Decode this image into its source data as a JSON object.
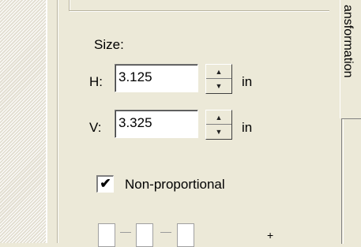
{
  "size": {
    "label": "Size:",
    "h": {
      "label": "H:",
      "value": "3.125",
      "unit": "in"
    },
    "v": {
      "label": "V:",
      "value": "3.325",
      "unit": "in"
    }
  },
  "non_proportional": {
    "label": "Non-proportional",
    "checked": true,
    "check_glyph": "✔"
  },
  "side_tab": {
    "label": "ansformation"
  },
  "plus_symbol": "+",
  "icons": {
    "spin_up": "▲",
    "spin_down": "▼"
  }
}
